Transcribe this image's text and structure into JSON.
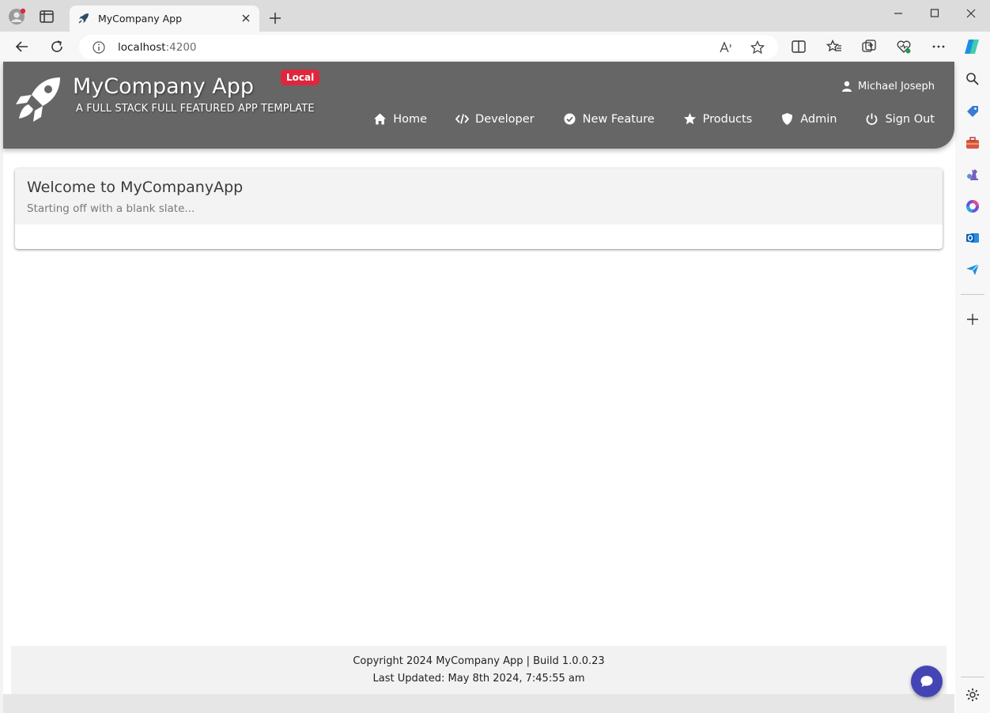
{
  "browser": {
    "tab_title": "MyCompany App",
    "url_host": "localhost",
    "url_port": ":4200"
  },
  "header": {
    "title": "MyCompany App",
    "subtitle": "A FULL STACK FULL FEATURED APP TEMPLATE",
    "environment_badge": "Local",
    "user_name": "Michael Joseph",
    "nav": [
      {
        "label": "Home",
        "icon": "home-icon"
      },
      {
        "label": "Developer",
        "icon": "code-icon"
      },
      {
        "label": "New Feature",
        "icon": "check-circle-icon"
      },
      {
        "label": "Products",
        "icon": "star-icon"
      },
      {
        "label": "Admin",
        "icon": "shield-icon"
      },
      {
        "label": "Sign Out",
        "icon": "power-icon"
      }
    ]
  },
  "card": {
    "title": "Welcome to MyCompanyApp",
    "subtitle": "Starting off with a blank slate..."
  },
  "footer": {
    "line1": "Copyright 2024 MyCompany App | Build 1.0.0.23",
    "line2": "Last Updated: May 8th 2024, 7:45:55 am"
  },
  "colors": {
    "header_bg": "#666666",
    "badge_bg": "#e0263d",
    "chat_button_bg": "#4345b5"
  }
}
